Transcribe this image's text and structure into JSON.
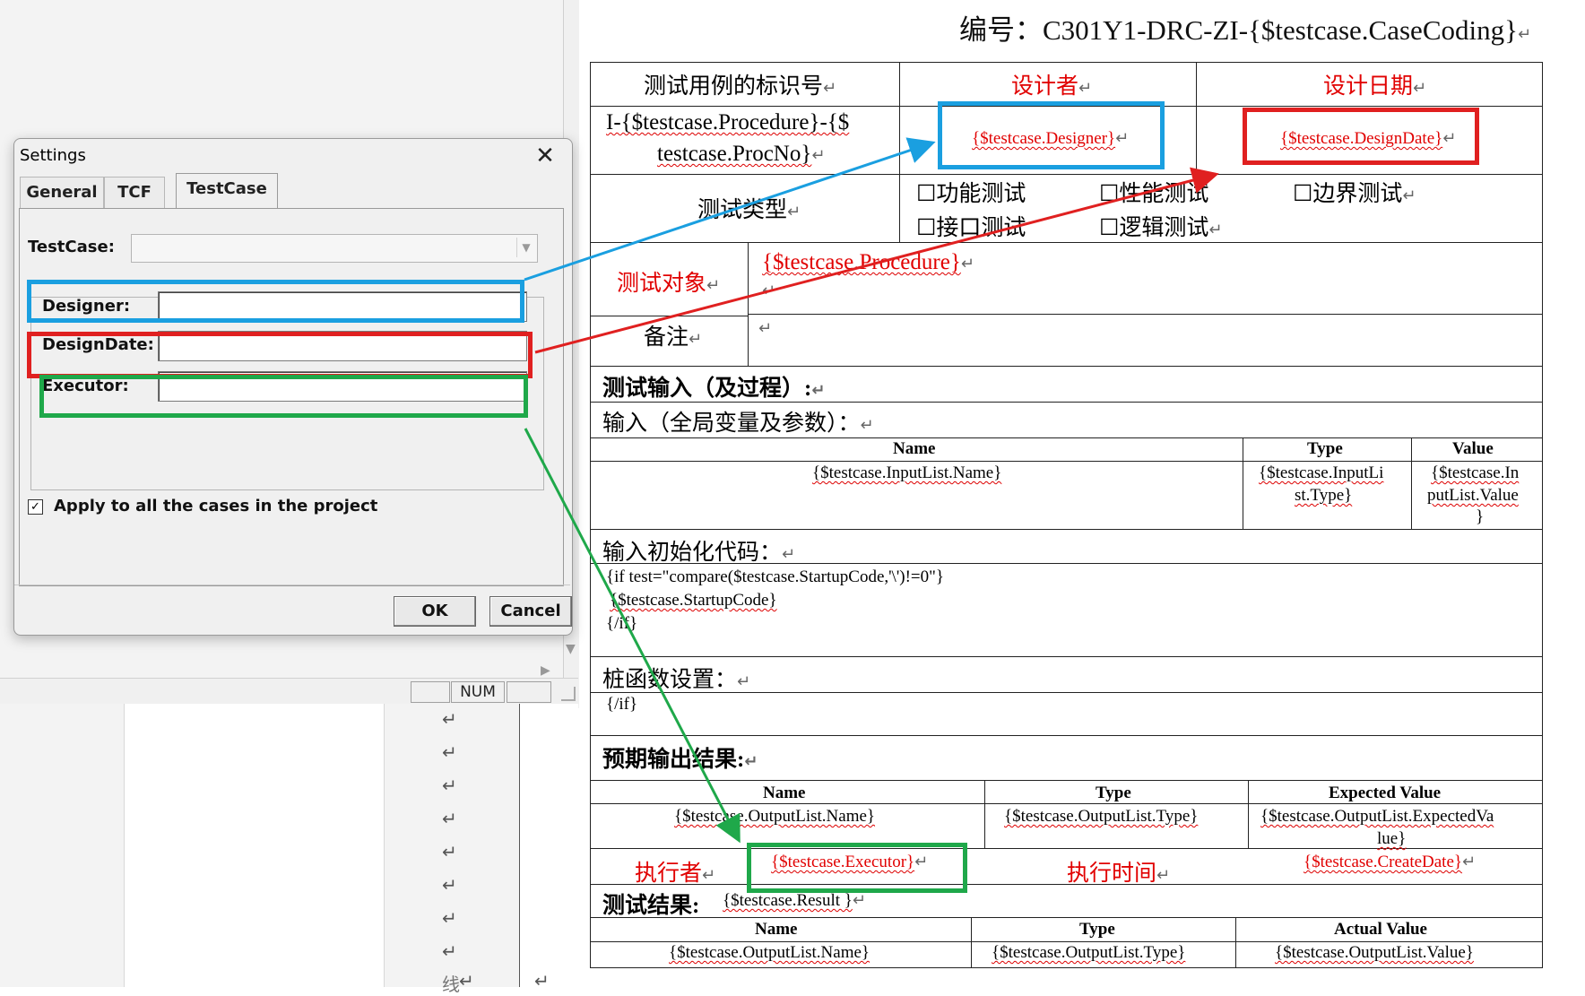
{
  "background": {
    "statusbar": {
      "num": "NUM"
    },
    "return_mark": "↵",
    "bottom_text": "线"
  },
  "dialog": {
    "title": "Settings",
    "close_icon": "✕",
    "tabs": [
      {
        "label": "General"
      },
      {
        "label": "TCF"
      },
      {
        "label": "TestCase",
        "active": true
      }
    ],
    "fields": {
      "testcase_label": "TestCase:",
      "testcase_value": "",
      "designer_label": "Designer:",
      "designer_value": "",
      "designdate_label": "DesignDate:",
      "designdate_value": "",
      "executor_label": "Executor:",
      "executor_value": ""
    },
    "apply_all": {
      "checked": true,
      "check_mark": "✓",
      "label": "Apply to all the cases in the project"
    },
    "ok_label": "OK",
    "cancel_label": "Cancel"
  },
  "highlight_colors": {
    "designer": "#1a9fe0",
    "designdate": "#e02020",
    "executor": "#1fa84a"
  },
  "document": {
    "title": "编号：C301Y1-DRC-ZI-{$testcase.CaseCoding}",
    "header_row": {
      "id_label": "测试用例的标识号",
      "designer_label": "设计者",
      "date_label": "设计日期"
    },
    "id_value_line1": "I-{$testcase.Procedure}-{$",
    "id_value_line2": "testcase.ProcNo}",
    "designer_value": "{$testcase.Designer}",
    "designdate_value": "{$testcase.DesignDate}",
    "test_type_label": "测试类型",
    "test_types": [
      "☐功能测试",
      "☐性能测试",
      "☐边界测试",
      "☐接口测试",
      "☐逻辑测试"
    ],
    "test_object_label": "测试对象",
    "test_object_value": "{$testcase.Procedure}",
    "remarks_label": "备注",
    "test_input_heading": "测试输入（及过程）:",
    "input_heading": "输入（全局变量及参数）：",
    "input_table": {
      "headers": [
        "Name",
        "Type",
        "Value"
      ],
      "row": [
        "{$testcase.InputList.Name}",
        "{$testcase.InputLi",
        "st.Type}",
        "{$testcase.In",
        "putList.Value",
        "}"
      ]
    },
    "init_code_heading": "输入初始化代码：",
    "init_code_lines": [
      "{if test=\"compare($testcase.StartupCode,'\\')!=0\"}",
      "{$testcase.StartupCode}",
      "{/if}"
    ],
    "stub_heading": "桩函数设置：",
    "stub_line": "{/if}",
    "expected_heading": "预期输出结果:",
    "output_table": {
      "headers": [
        "Name",
        "Type",
        "Expected Value"
      ],
      "row": [
        "{$testcase.OutputList.Name}",
        "{$testcase.OutputList.Type}",
        "{$testcase.OutputList.ExpectedVa",
        "lue}"
      ]
    },
    "executor_label": "执行者",
    "executor_value": "{$testcase.Executor}",
    "exec_time_label": "执行时间",
    "create_date_value": "{$testcase.CreateDate}",
    "result_heading": "测试结果:",
    "result_value": "{$testcase.Result }",
    "result_table": {
      "headers": [
        "Name",
        "Type",
        "Actual Value"
      ],
      "row": [
        "{$testcase.OutputList.Name}",
        "{$testcase.OutputList.Type}",
        "{$testcase.OutputList.Value}"
      ]
    }
  }
}
